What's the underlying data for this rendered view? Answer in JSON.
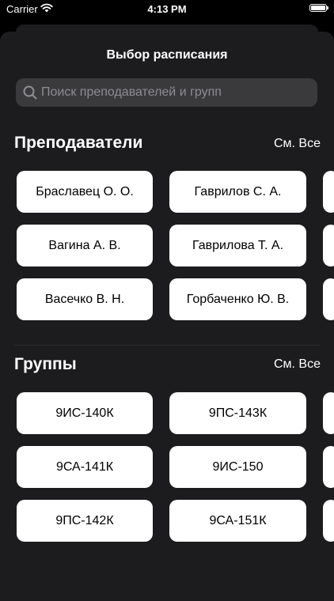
{
  "status_bar": {
    "carrier": "Carrier",
    "time": "4:13 PM"
  },
  "sheet": {
    "title": "Выбор расписания",
    "search_placeholder": "Поиск преподавателей и групп"
  },
  "teachers": {
    "title": "Преподаватели",
    "see_all": "См. Все",
    "items": [
      "Браславец О. О.",
      "Гаврилов С. А.",
      "Вагина А. В.",
      "Гаврилова Т. А.",
      "Васечко В. Н.",
      "Горбаченко Ю. В."
    ]
  },
  "groups": {
    "title": "Группы",
    "see_all": "См. Все",
    "items": [
      "9ИС-140К",
      "9ПС-143К",
      "9СА-141К",
      "9ИС-150",
      "9ПС-142К",
      "9СА-151К"
    ]
  },
  "colors": {
    "background": "#000000",
    "sheet": "#1c1c1e",
    "search_field": "#3a3a3c",
    "chip": "#ffffff"
  }
}
